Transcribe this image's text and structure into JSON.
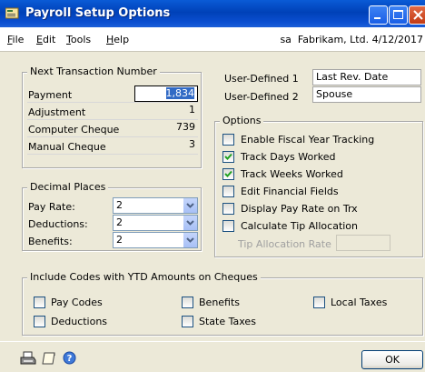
{
  "window": {
    "title": "Payroll Setup Options",
    "icon": "payroll-window-icon"
  },
  "menu": {
    "items": [
      {
        "label_u": "F",
        "label_rest": "ile"
      },
      {
        "label_u": "E",
        "label_rest": "dit"
      },
      {
        "label_u": "T",
        "label_rest": "ools"
      },
      {
        "label_u": "H",
        "label_rest": "elp"
      }
    ],
    "user": "sa",
    "company": "Fabrikam, Ltd.",
    "date": "4/12/2017"
  },
  "next_transaction": {
    "legend": "Next Transaction Number",
    "rows": [
      {
        "label": "Payment",
        "value": "1,834"
      },
      {
        "label": "Adjustment",
        "value": "1"
      },
      {
        "label": "Computer Cheque",
        "value": "739"
      },
      {
        "label": "Manual Cheque",
        "value": "3"
      }
    ]
  },
  "user_defined": {
    "rows": [
      {
        "label": "User-Defined 1",
        "value": "Last Rev. Date"
      },
      {
        "label": "User-Defined 2",
        "value": "Spouse"
      }
    ]
  },
  "decimal_places": {
    "legend": "Decimal Places",
    "rows": [
      {
        "label": "Pay Rate:",
        "value": "2"
      },
      {
        "label": "Deductions:",
        "value": "2"
      },
      {
        "label": "Benefits:",
        "value": "2"
      }
    ]
  },
  "options": {
    "legend": "Options",
    "items": [
      {
        "label": "Enable Fiscal Year Tracking",
        "checked": false
      },
      {
        "label": "Track Days Worked",
        "checked": true
      },
      {
        "label": "Track Weeks Worked",
        "checked": true
      },
      {
        "label": "Edit Financial Fields",
        "checked": false
      },
      {
        "label": "Display Pay Rate on Trx",
        "checked": false
      },
      {
        "label": "Calculate Tip Allocation",
        "checked": false
      }
    ],
    "tip_rate_label": "Tip Allocation Rate",
    "tip_rate_value": ""
  },
  "ytd_codes": {
    "legend": "Include Codes with YTD Amounts on Cheques",
    "items": [
      {
        "label": "Pay Codes",
        "checked": false
      },
      {
        "label": "Benefits",
        "checked": false
      },
      {
        "label": "Local Taxes",
        "checked": false
      },
      {
        "label": "Deductions",
        "checked": false
      },
      {
        "label": "State Taxes",
        "checked": false
      }
    ]
  },
  "footer": {
    "ok_label": "OK",
    "icons": [
      "printer-icon",
      "note-icon",
      "help-icon"
    ]
  },
  "colors": {
    "titlebar": "#0a4ed0",
    "window_bg": "#ece9d8",
    "selection": "#316ac5"
  }
}
